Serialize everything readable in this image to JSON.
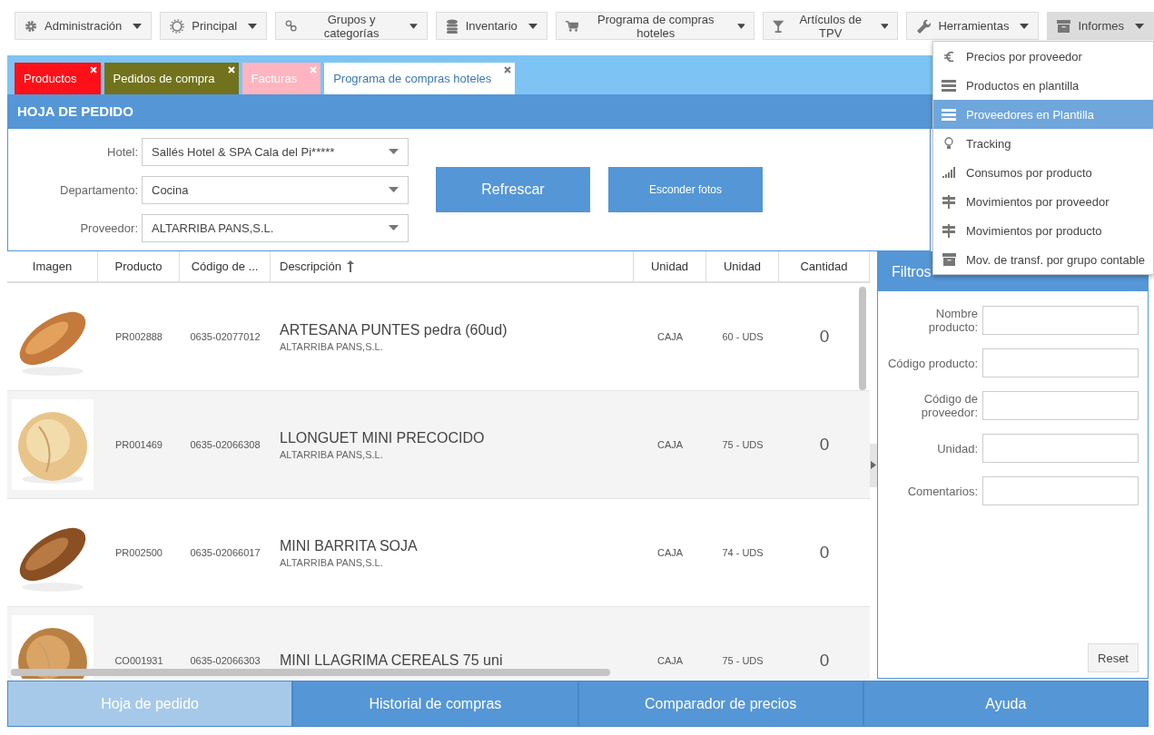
{
  "nav": [
    {
      "label": "Administración",
      "selected": false
    },
    {
      "label": "Principal",
      "selected": false
    },
    {
      "label": "Grupos y categorías",
      "selected": false
    },
    {
      "label": "Inventario",
      "selected": false
    },
    {
      "label": "Programa de compras hoteles",
      "selected": false
    },
    {
      "label": "Artículos de TPV",
      "selected": false
    },
    {
      "label": "Herramientas",
      "selected": false
    },
    {
      "label": "Informes",
      "selected": true
    }
  ],
  "tabs": [
    {
      "label": "Productos",
      "color": "#ff1018",
      "selected": false
    },
    {
      "label": "Pedidos de compra",
      "color": "#72721c",
      "selected": false
    },
    {
      "label": "Facturas",
      "color": "#ffb5c0",
      "selected": false
    },
    {
      "label": "Programa de compras hoteles",
      "color": "#ffffff",
      "selected": true
    }
  ],
  "panel_title": "HOJA DE PEDIDO",
  "form": [
    {
      "label": "Hotel:",
      "value": "Sallés Hotel & SPA Cala del Pi*****"
    },
    {
      "label": "Departamento:",
      "value": "Cocina"
    },
    {
      "label": "Proveedor:",
      "value": "ALTARRIBA PANS,S.L."
    }
  ],
  "buttons": [
    "Refrescar",
    "Esconder fotos"
  ],
  "table": {
    "columns": [
      "Imagen",
      "Producto",
      "Código de ...",
      "Descripción",
      "Unidad",
      "Unidad",
      "Cantidad"
    ],
    "rows": [
      {
        "product": "PR002888",
        "code": "0635-02077012",
        "description": "ARTESANA PUNTES pedra (60ud)",
        "supplier": "ALTARRIBA PANS,S.L.",
        "unit": "CAJA",
        "unit_2": "60 - UDS",
        "quantity": "0"
      },
      {
        "product": "PR001469",
        "code": "0635-02066308",
        "description": "LLONGUET MINI PRECOCIDO",
        "supplier": "ALTARRIBA PANS,S.L.",
        "unit": "CAJA",
        "unit_2": "75 - UDS",
        "quantity": "0"
      },
      {
        "product": "PR002500",
        "code": "0635-02066017",
        "description": "MINI BARRITA SOJA",
        "supplier": "ALTARRIBA PANS,S.L.",
        "unit": "CAJA",
        "unit_2": "74 - UDS",
        "quantity": "0"
      },
      {
        "product": "CO001931",
        "code": "0635-02066303",
        "description": "MINI LLAGRIMA CEREALS 75 uni",
        "unit": "CAJA",
        "unit_2": "75 - UDS",
        "quantity": "0"
      }
    ]
  },
  "filters": {
    "title": "Filtros",
    "fields": [
      "Nombre producto:",
      "Código producto:",
      "Código de proveedor:",
      "Unidad:",
      "Comentarios:"
    ],
    "reset": "Reset"
  },
  "bottom_tabs": [
    {
      "label": "Hoja de pedido",
      "selected": true
    },
    {
      "label": "Historial de compras",
      "selected": false
    },
    {
      "label": "Comparador de precios",
      "selected": false
    },
    {
      "label": "Ayuda",
      "selected": false
    }
  ],
  "menu": [
    {
      "label": "Precios por proveedor",
      "selected": false
    },
    {
      "label": "Productos en plantilla",
      "selected": false
    },
    {
      "label": "Proveedores en Plantilla",
      "selected": true
    },
    {
      "label": "Tracking",
      "selected": false
    },
    {
      "label": "Consumos por producto",
      "selected": false
    },
    {
      "label": "Movimientos por proveedor",
      "selected": false
    },
    {
      "label": "Movimientos por producto",
      "selected": false
    },
    {
      "label": "Mov. de transf. por grupo contable",
      "selected": false
    }
  ]
}
